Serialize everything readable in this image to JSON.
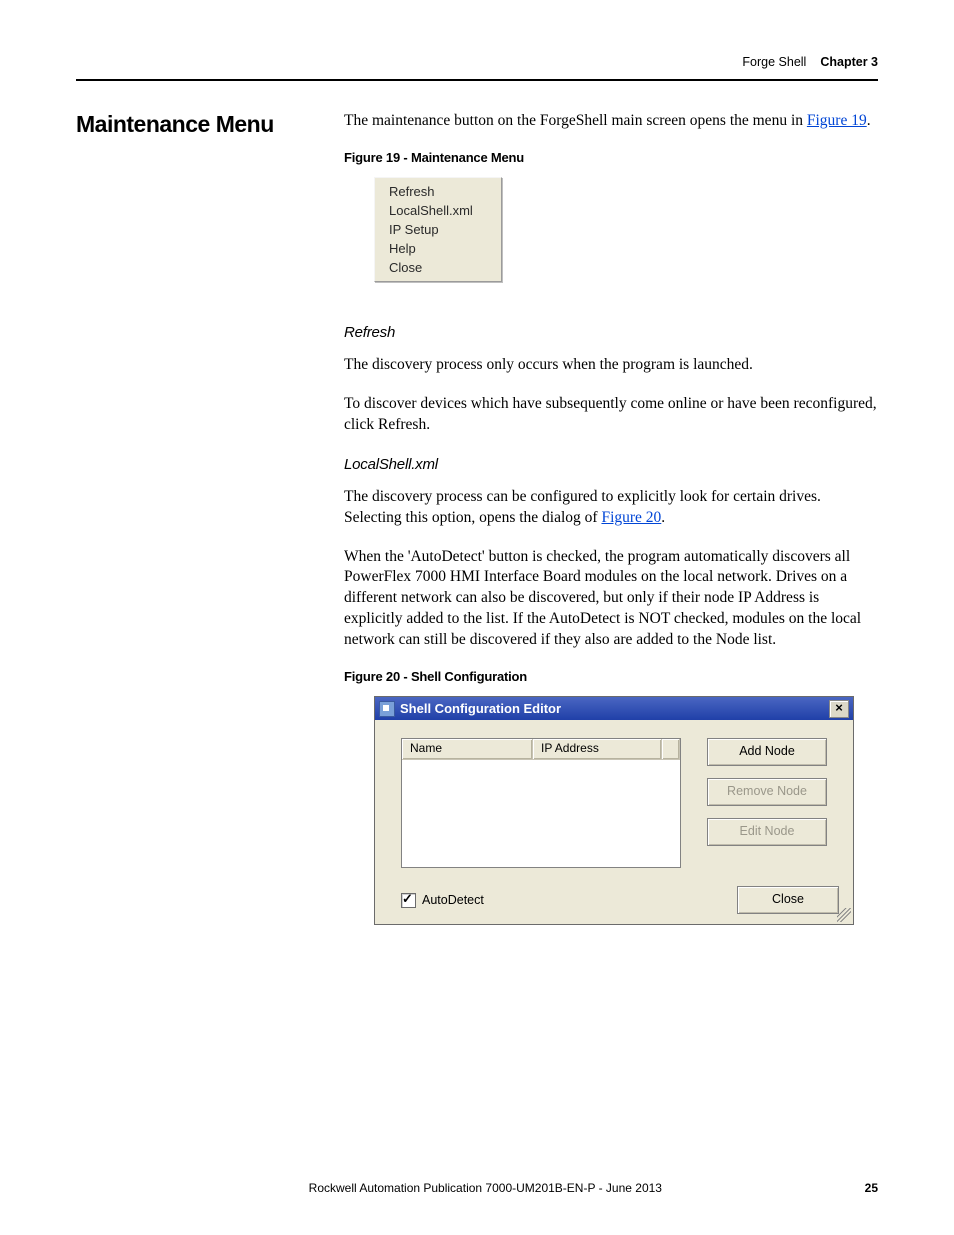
{
  "header": {
    "section": "Forge Shell",
    "chapter": "Chapter 3"
  },
  "heading": "Maintenance Menu",
  "intro": {
    "text_before_link": "The maintenance button on the ForgeShell main screen opens the menu in ",
    "link": "Figure 19",
    "text_after_link": "."
  },
  "figure19": {
    "caption": "Figure 19 - Maintenance Menu",
    "menu_items": [
      "Refresh",
      "LocalShell.xml",
      "IP Setup",
      "Help",
      "Close"
    ]
  },
  "refresh": {
    "heading": "Refresh",
    "p1": "The discovery process only occurs when the program is launched.",
    "p2": "To discover devices which have subsequently come online or have been reconfigured, click Refresh."
  },
  "localshell": {
    "heading": "LocalShell.xml",
    "p1_before": "The discovery process can be configured to explicitly look for certain drives. Selecting this option, opens the dialog of ",
    "p1_link": "Figure 20",
    "p1_after": ".",
    "p2": "When the 'AutoDetect' button is checked, the program automatically discovers all PowerFlex 7000 HMI Interface Board modules on the local network. Drives on a different network can also be discovered, but only if their node IP Address is explicitly added to the list. If the AutoDetect is NOT checked, modules on the local network can still be discovered if they also are added to the Node list."
  },
  "figure20": {
    "caption": "Figure 20 - Shell Configuration",
    "dialog": {
      "title": "Shell Configuration Editor",
      "columns": {
        "name": "Name",
        "ip": "IP Address"
      },
      "buttons": {
        "add": "Add Node",
        "remove": "Remove Node",
        "edit": "Edit Node",
        "close": "Close"
      },
      "checkbox": {
        "label": "AutoDetect",
        "checked": true
      }
    }
  },
  "footer": {
    "publication": "Rockwell Automation Publication 7000-UM201B-EN-P - June 2013",
    "page": "25"
  }
}
